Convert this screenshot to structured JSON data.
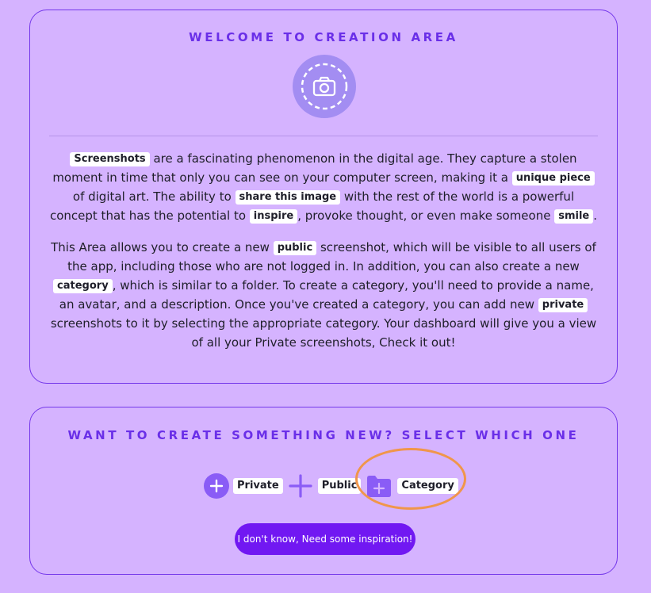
{
  "welcome": {
    "title": "WELCOME TO CREATION AREA",
    "avatar_icon": "camera-icon",
    "paragraph1": [
      {
        "tag": "Screenshots"
      },
      {
        "text": " are a fascinating phenomenon in the digital age. They capture a stolen moment in time that only you can see on your computer screen, making it a "
      },
      {
        "tag": "unique piece"
      },
      {
        "text": " of digital art. The ability to "
      },
      {
        "tag": "share this image"
      },
      {
        "text": " with the rest of the world is a powerful concept that has the potential to "
      },
      {
        "tag": "inspire"
      },
      {
        "text": ", provoke thought, or even make someone "
      },
      {
        "tag": "smile"
      },
      {
        "text": "."
      }
    ],
    "paragraph2": [
      {
        "text": "This Area allows you to create a new "
      },
      {
        "tag": "public"
      },
      {
        "text": " screenshot, which will be visible to all users of the app, including those who are not logged in. In addition, you can also create a new "
      },
      {
        "tag": "category"
      },
      {
        "text": ", which is similar to a folder. To create a category, you'll need to provide a name, an avatar, and a description. Once you've created a category, you can add new "
      },
      {
        "tag": "private"
      },
      {
        "text": " screenshots to it by selecting the appropriate category. Your dashboard will give you a view of all your Private screenshots, Check it out!"
      }
    ]
  },
  "create": {
    "title": "WANT TO CREATE SOMETHING NEW? SELECT WHICH ONE",
    "options": [
      {
        "label": "Private",
        "icon": "plus-circle-icon"
      },
      {
        "label": "Public",
        "icon": "plus-icon"
      },
      {
        "label": "Category",
        "icon": "folder-plus-icon"
      }
    ],
    "inspire_button": "I don't know, Need some inspiration!"
  },
  "colors": {
    "background": "#d5b3ff",
    "accent": "#7437ea",
    "button": "#7118f2",
    "highlight_ring": "#f0964a"
  }
}
